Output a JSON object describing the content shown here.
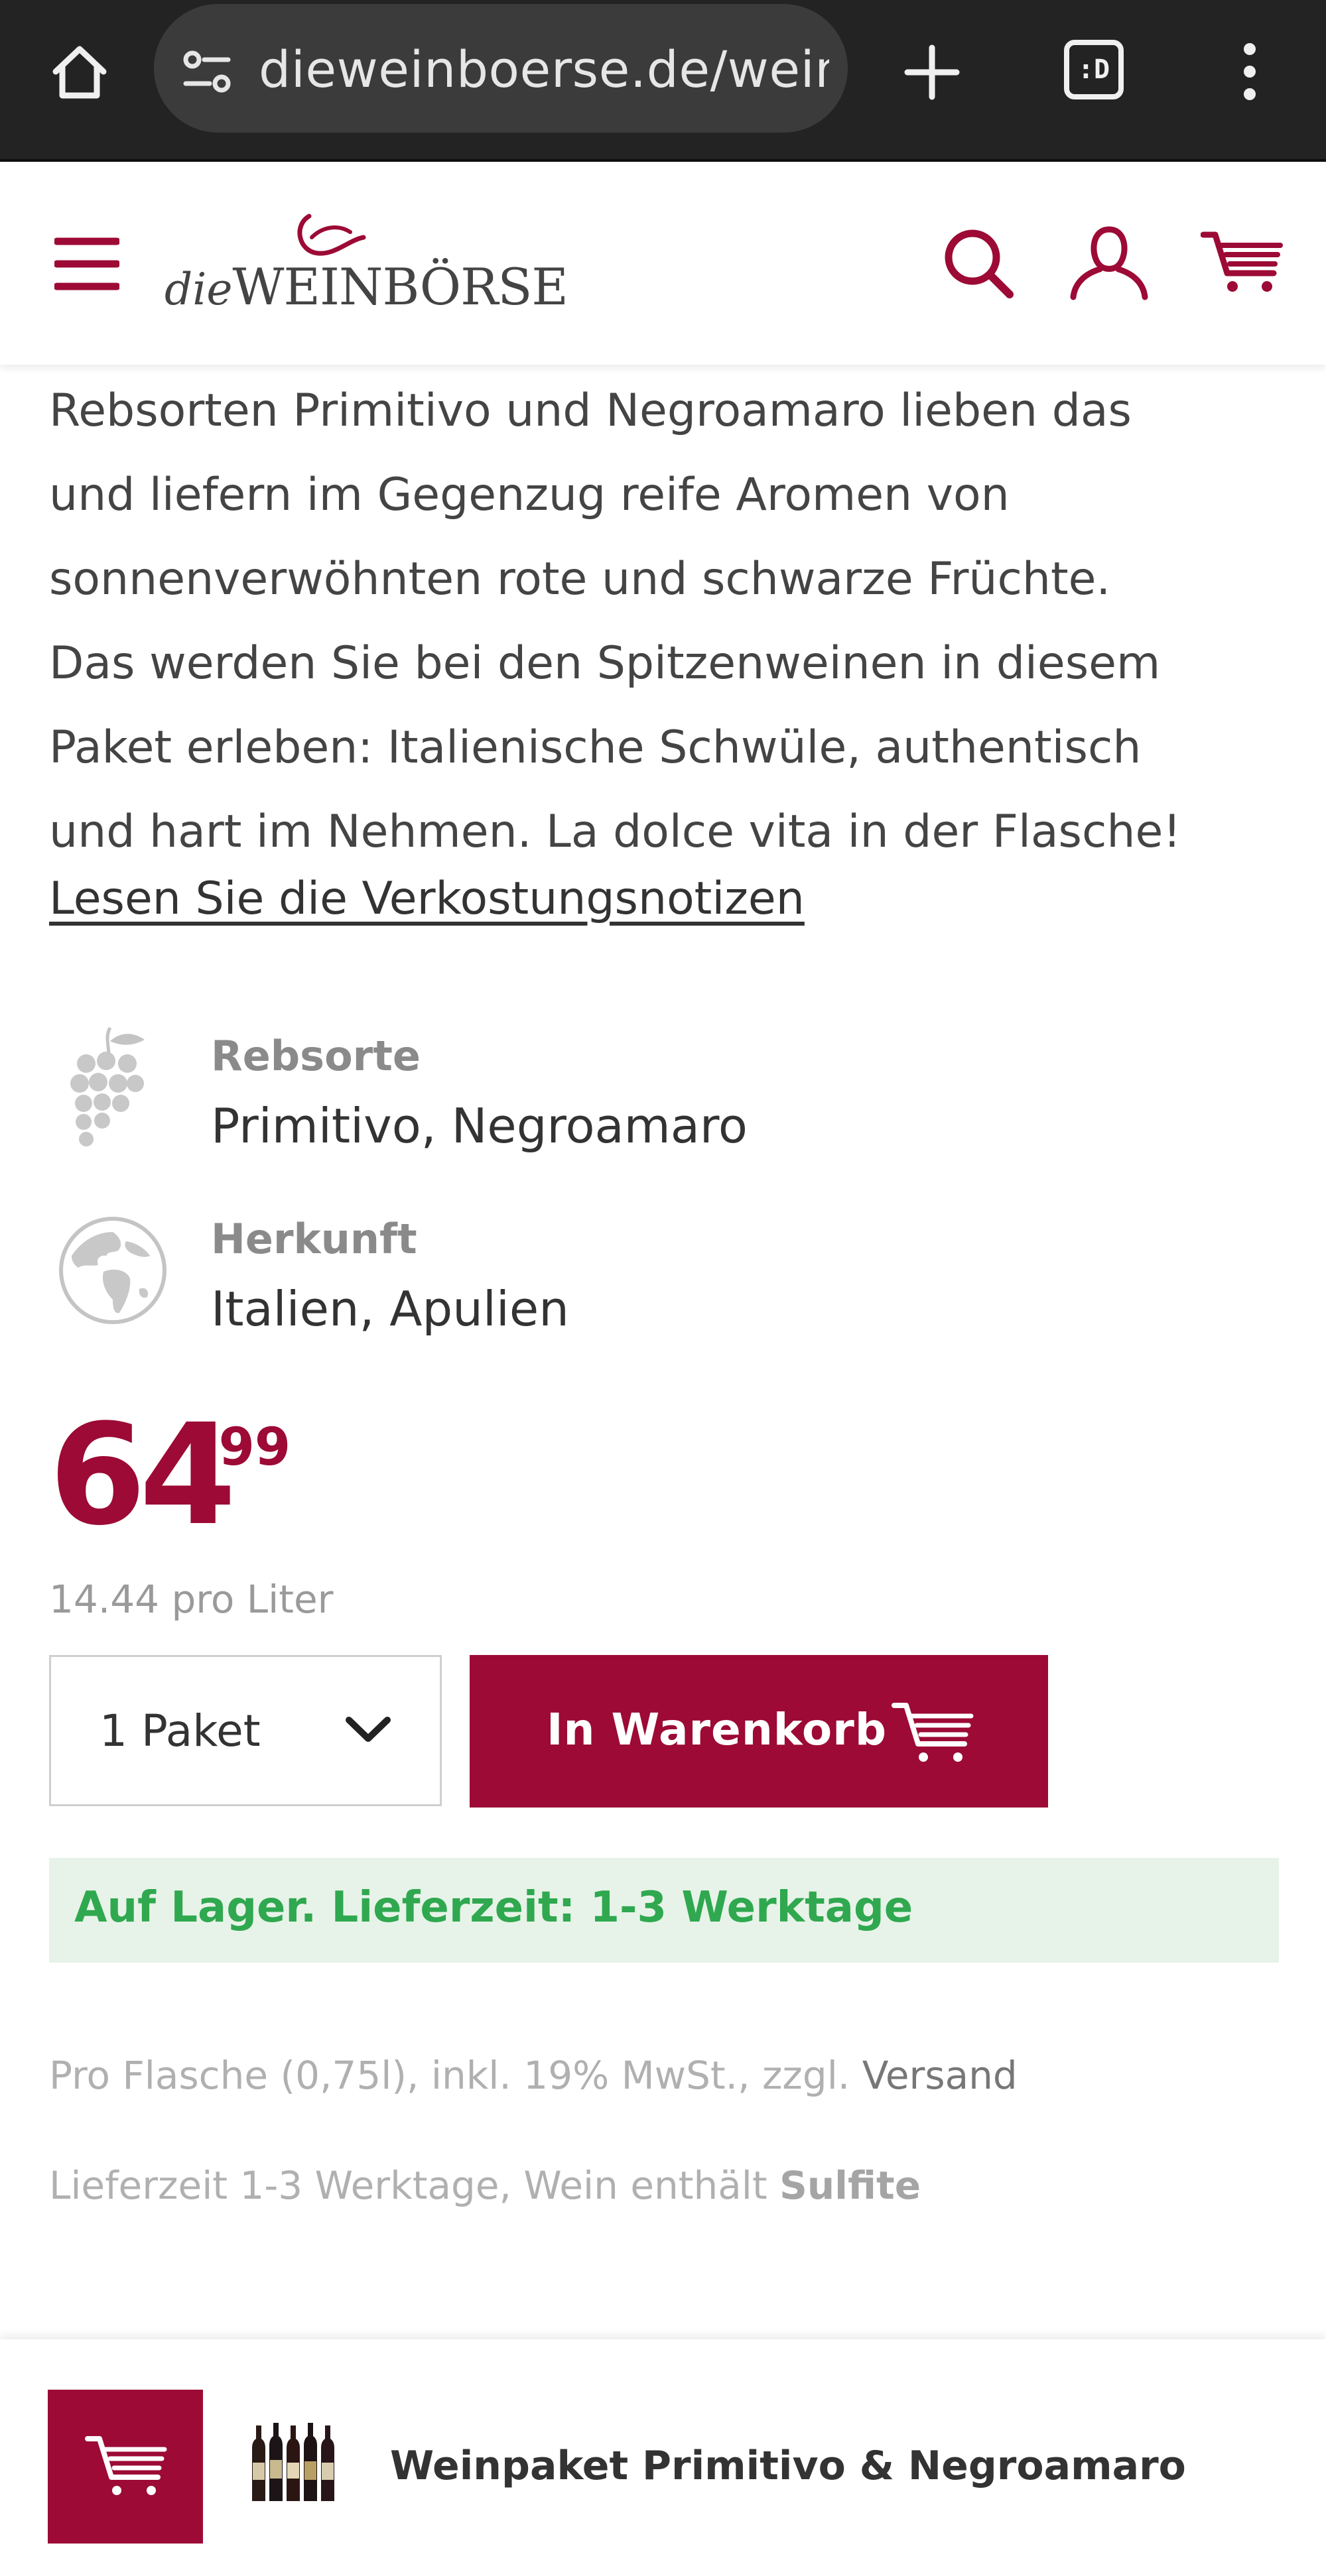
{
  "browser": {
    "url": "dieweinboerse.de/wein",
    "tab_count_label": ":D"
  },
  "header": {
    "logo_prefix": "die",
    "logo_main": "WEINBÖRSE"
  },
  "product": {
    "description_lines": [
      "Rebsorten Primitivo und Negroamaro lieben das",
      "und liefern im Gegenzug reife Aromen von",
      "sonnenverwöhnten rote und schwarze Früchte.",
      "Das werden Sie bei den Spitzenweinen in diesem",
      "Paket erleben: Italienische Schwüle, authentisch",
      "und hart im Nehmen. La dolce vita in der Flasche!"
    ],
    "tasting_notes_link": "Lesen Sie die Verkostungsnotizen",
    "attributes": [
      {
        "label": "Rebsorte",
        "value": "Primitivo, Negroamaro",
        "icon": "grape-icon"
      },
      {
        "label": "Herkunft",
        "value": "Italien, Apulien",
        "icon": "globe-icon"
      }
    ],
    "price_main": "64",
    "price_cents": ",99",
    "price_per_liter": "14.44 pro Liter",
    "quantity": "1 Paket",
    "add_to_cart_label": "In Warenkorb",
    "stock_text": "Auf Lager. Lieferzeit: 1-3 Werktage",
    "legal_line1_text": "Pro Flasche (0,75l), inkl. 19% MwSt., zzgl. ",
    "legal_line1_link": "Versand",
    "legal_line2_text": "Lieferzeit 1-3 Werktage, Wein enthält ",
    "legal_line2_bold": "Sulfite",
    "name": "Weinpaket Primitivo & Negroamaro"
  },
  "colors": {
    "brand": "#9c0a35",
    "stock_green": "#2fa84f",
    "stock_bg": "#e7f3e8"
  }
}
